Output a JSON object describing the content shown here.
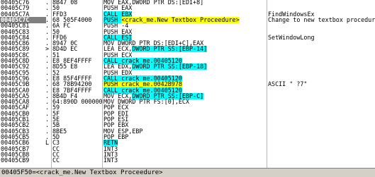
{
  "status_line": "00405F50=<crack_me.New Textbox Proceedure>",
  "rows": [
    {
      "addr": "00405C76",
      "mark": ".",
      "hex": "8B47 08",
      "dis": [
        {
          "t": "MOV EAX,DWORD PTR DS:[EDI+8]",
          "c": "plain"
        }
      ],
      "com": "",
      "sel": false
    },
    {
      "addr": "00405C79",
      "mark": ".",
      "hex": "50",
      "dis": [
        {
          "t": "PUSH EAX",
          "c": "plain"
        }
      ],
      "com": "",
      "sel": false
    },
    {
      "addr": "00405C7A",
      "mark": ".",
      "hex": "FFD3",
      "dis": [
        {
          "t": "CALL EBX",
          "c": "blue"
        }
      ],
      "com": "FindWindowsEx",
      "sel": false
    },
    {
      "addr": "00405C7C",
      "mark": ".",
      "hex": "68 505F4000",
      "dis": [
        {
          "t": "PUSH ",
          "c": "blue"
        },
        {
          "t": "<crack_me.New Textbox Proceedure>",
          "c": "yellow"
        }
      ],
      "com": "Change to new textbox procedure",
      "sel": true
    },
    {
      "addr": "00405C81",
      "mark": ".",
      "hex": "6A FC",
      "dis": [
        {
          "t": "PUSH -4",
          "c": "plain"
        }
      ],
      "com": "",
      "sel": false
    },
    {
      "addr": "00405C83",
      "mark": ".",
      "hex": "50",
      "dis": [
        {
          "t": "PUSH EAX",
          "c": "plain"
        }
      ],
      "com": "",
      "sel": false
    },
    {
      "addr": "00405C84",
      "mark": ".",
      "hex": "FFD6",
      "dis": [
        {
          "t": "CALL ESI",
          "c": "blue"
        }
      ],
      "com": "SetWindowLong",
      "sel": false
    },
    {
      "addr": "00405C86",
      "mark": ".",
      "hex": "8947 0C",
      "dis": [
        {
          "t": "MOV DWORD PTR DS:[EDI+C],EAX",
          "c": "plain"
        }
      ],
      "com": "",
      "sel": false
    },
    {
      "addr": "00405C89",
      "mark": ">",
      "hex": "8D4D EC",
      "dis": [
        {
          "t": "LEA ECX,",
          "c": "plain"
        },
        {
          "t": "DWORD PTR SS:[EBP-14]",
          "c": "blue"
        }
      ],
      "com": "",
      "sel": false
    },
    {
      "addr": "00405C8C",
      "mark": ".",
      "hex": "51",
      "dis": [
        {
          "t": "PUSH ECX",
          "c": "plain"
        }
      ],
      "com": "",
      "sel": false
    },
    {
      "addr": "00405C8D",
      "mark": ".",
      "hex": "E8 8EF4FFFF",
      "dis": [
        {
          "t": "CALL crack_me.00405120",
          "c": "blue"
        }
      ],
      "com": "",
      "sel": false
    },
    {
      "addr": "00405C92",
      "mark": ".",
      "hex": "8D55 E8",
      "dis": [
        {
          "t": "LEA EDX,",
          "c": "plain"
        },
        {
          "t": "DWORD PTR SS:[EBP-18]",
          "c": "blue"
        }
      ],
      "com": "",
      "sel": false
    },
    {
      "addr": "00405C95",
      "mark": ".",
      "hex": "52",
      "dis": [
        {
          "t": "PUSH EDX",
          "c": "plain"
        }
      ],
      "com": "",
      "sel": false
    },
    {
      "addr": "00405C96",
      "mark": ".",
      "hex": "E8 85F4FFFF",
      "dis": [
        {
          "t": "CALL crack_me.00405120",
          "c": "blue"
        }
      ],
      "com": "",
      "sel": false
    },
    {
      "addr": "00405C9B",
      "mark": ".",
      "hex": "68 78B94200",
      "dis": [
        {
          "t": "PUSH crack_me.0042B978",
          "c": "yellow"
        }
      ],
      "com": "ASCII \" ?7\"",
      "sel": false
    },
    {
      "addr": "00405CA0",
      "mark": ".",
      "hex": "E8 7BF4FFFF",
      "dis": [
        {
          "t": "CALL crack_me.00405120",
          "c": "blue"
        }
      ],
      "com": "",
      "sel": false
    },
    {
      "addr": "00405CA5",
      "mark": ".",
      "hex": "8B4D F4",
      "dis": [
        {
          "t": "MOV ECX,",
          "c": "plain"
        },
        {
          "t": "DWORD PTR SS:[EBP-C]",
          "c": "blue"
        }
      ],
      "com": "",
      "sel": false
    },
    {
      "addr": "00405CA8",
      "mark": ".",
      "hex": "64:890D 0000000",
      "dis": [
        {
          "t": "MOV DWORD PTR FS:[0],ECX",
          "c": "plain"
        }
      ],
      "com": "",
      "sel": false
    },
    {
      "addr": "00405CAF",
      "mark": ".",
      "hex": "59",
      "dis": [
        {
          "t": "POP ECX",
          "c": "plain"
        }
      ],
      "com": "",
      "sel": false
    },
    {
      "addr": "00405CB0",
      "mark": ".",
      "hex": "5F",
      "dis": [
        {
          "t": "POP EDI",
          "c": "plain"
        }
      ],
      "com": "",
      "sel": false
    },
    {
      "addr": "00405CB1",
      "mark": ".",
      "hex": "5E",
      "dis": [
        {
          "t": "POP ESI",
          "c": "plain"
        }
      ],
      "com": "",
      "sel": false
    },
    {
      "addr": "00405CB2",
      "mark": ".",
      "hex": "5B",
      "dis": [
        {
          "t": "POP EBX",
          "c": "plain"
        }
      ],
      "com": "",
      "sel": false
    },
    {
      "addr": "00405CB3",
      "mark": ".",
      "hex": "8BE5",
      "dis": [
        {
          "t": "MOV ESP,EBP",
          "c": "plain"
        }
      ],
      "com": "",
      "sel": false
    },
    {
      "addr": "00405CB5",
      "mark": ".",
      "hex": "5D",
      "dis": [
        {
          "t": "POP EBP",
          "c": "plain"
        }
      ],
      "com": "",
      "sel": false
    },
    {
      "addr": "00405CB6",
      "mark": "L",
      "hex": "C3",
      "dis": [
        {
          "t": "RETN",
          "c": "blue"
        }
      ],
      "com": "",
      "sel": false
    },
    {
      "addr": "00405CB7",
      "mark": "",
      "hex": "CC",
      "dis": [
        {
          "t": "INT3",
          "c": "plain"
        }
      ],
      "com": "",
      "sel": false
    },
    {
      "addr": "00405CB8",
      "mark": "",
      "hex": "CC",
      "dis": [
        {
          "t": "INT3",
          "c": "plain"
        }
      ],
      "com": "",
      "sel": false
    },
    {
      "addr": "00405CB9",
      "mark": "",
      "hex": "CC",
      "dis": [
        {
          "t": "INT3",
          "c": "plain"
        }
      ],
      "com": "",
      "sel": false
    }
  ]
}
